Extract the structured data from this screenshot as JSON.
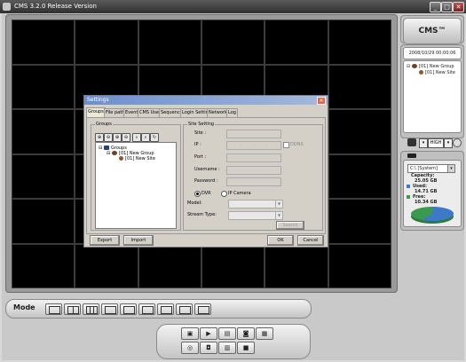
{
  "window": {
    "title": "CMS  3.2.0 Release Version",
    "btn_min": "_",
    "btn_max": "□",
    "btn_close": "✕"
  },
  "sidebar": {
    "logo": "CMS™",
    "datetime": "2008/10/29 00:00:06",
    "tree": [
      {
        "toggle": "⊟",
        "label": "[01] New Group"
      },
      {
        "label": "[01] New Site"
      }
    ],
    "storage": {
      "drive": "C:\\ [System]",
      "capacity_label": "Capacity:",
      "capacity_value": "25.05 GB",
      "used_label": "Used:",
      "used_value": "14.71 GB",
      "free_label": "Free:",
      "free_value": "10.34 GB",
      "used_fraction": 0.587,
      "used_color": "#3e79c8",
      "free_color": "#3a9a50"
    },
    "quality": "HIGH"
  },
  "mode_bar": {
    "label": "Mode"
  },
  "dialog": {
    "title": "Settings",
    "close": "✕",
    "tabs": [
      "Groups",
      "File path",
      "Event",
      "CMS User",
      "Sequence",
      "Login Setting",
      "Network",
      "Log"
    ],
    "groups_box_title": "Groups",
    "toolbar_icons": [
      "⊕",
      "⊖",
      "⊕",
      "⊖",
      "⌕",
      "⌕",
      "↻"
    ],
    "tree": [
      {
        "toggle": "⊟",
        "label": "Groups"
      },
      {
        "toggle": "⊟",
        "label": "[01] New Group"
      },
      {
        "label": "[01] New Site"
      }
    ],
    "site_setting_title": "Site Setting",
    "fields": {
      "site": "Site :",
      "ip": "IP :",
      "port": "Port :",
      "username": "Username :",
      "password": "Password :",
      "model": "Model:",
      "stream_type": "Stream Type:"
    },
    "ip_dots": ".",
    "ddns_label": "DDNS",
    "radio_dvr": "DVR",
    "radio_ip_camera": "IP Camera",
    "search_button": "Search",
    "export_button": "Export",
    "import_button": "Import",
    "ok_button": "OK",
    "cancel_button": "Cancel"
  }
}
